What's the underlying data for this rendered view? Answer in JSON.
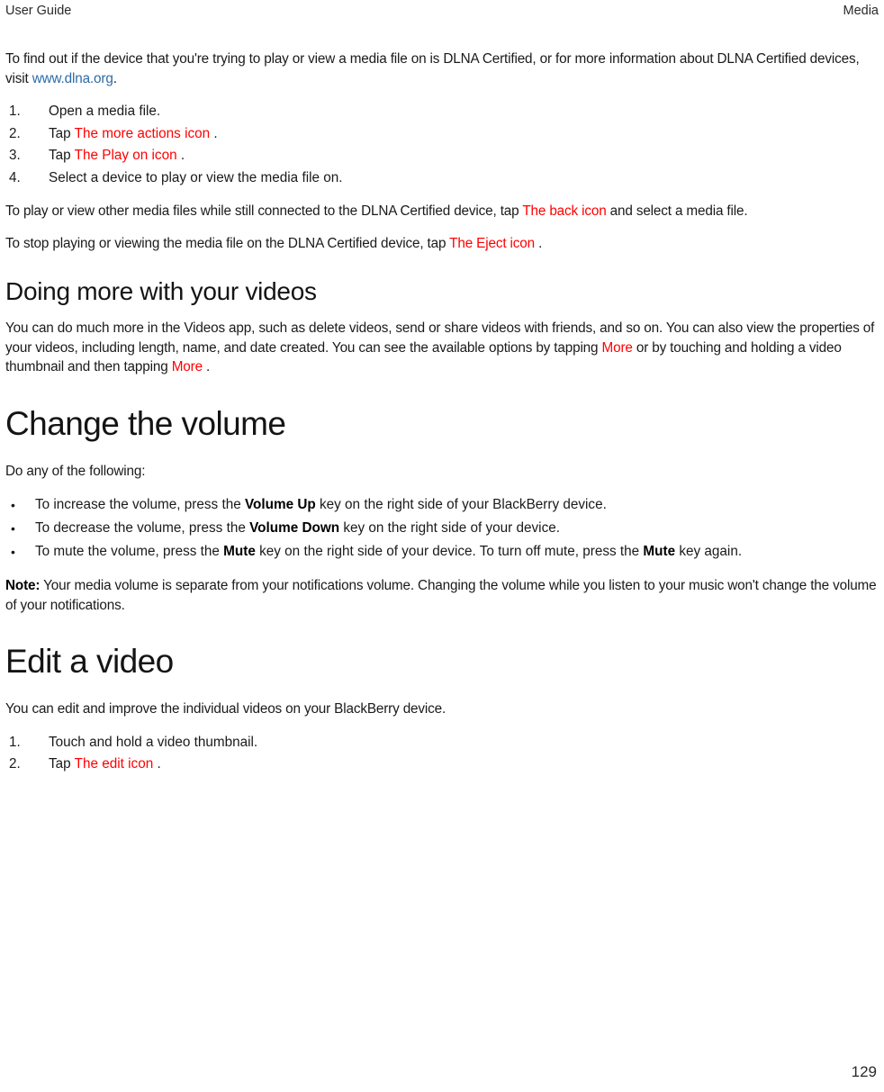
{
  "header": {
    "left": "User Guide",
    "right": "Media"
  },
  "colors": {
    "icon_reference": "#ff0000",
    "link": "#2d6ca8",
    "text": "#1a1a1a",
    "page_background": "#ffffff"
  },
  "intro": {
    "part1": "To find out if the device that you're trying to play or view a media file on is DLNA Certified, or for more information about DLNA Certified devices, visit ",
    "link_text": "www.dlna.org",
    "part2": "."
  },
  "dlna_steps": [
    {
      "number": "1.",
      "before": "Open a media file.",
      "icon": "",
      "after": ""
    },
    {
      "number": "2.",
      "before": "Tap ",
      "icon": "The more actions icon",
      "after": " ."
    },
    {
      "number": "3.",
      "before": "Tap ",
      "icon": "The Play on icon",
      "after": " ."
    },
    {
      "number": "4.",
      "before": "Select a device to play or view the media file on.",
      "icon": "",
      "after": ""
    }
  ],
  "after_steps": {
    "para1_before": "To play or view other media files while still connected to the DLNA Certified device, tap ",
    "para1_icon": "The back icon",
    "para1_after": " and select a media file.",
    "para2_before": "To stop playing or viewing the media file on the DLNA Certified device, tap ",
    "para2_icon": "The Eject icon",
    "para2_after": " ."
  },
  "doing_more": {
    "heading": "Doing more with your videos",
    "body_before": "You can do much more in the Videos app, such as delete videos, send or share videos with friends, and so on. You can also view the properties of your videos, including length, name, and date created. You can see the available options by tapping ",
    "icon1": "More",
    "body_middle": " or by touching and holding a video thumbnail and then tapping ",
    "icon2": "More",
    "body_after": " ."
  },
  "change_volume": {
    "heading": "Change the volume",
    "lead": "Do any of the following:",
    "bullets": [
      {
        "marker": "•",
        "before": "To increase the volume, press the ",
        "strong": "Volume Up",
        "after": " key on the right side of your BlackBerry device.",
        "strong2": "",
        "after2": ""
      },
      {
        "marker": "•",
        "before": "To decrease the volume, press the ",
        "strong": "Volume Down",
        "after": " key on the right side of your device.",
        "strong2": "",
        "after2": ""
      },
      {
        "marker": "•",
        "before": "To mute the volume, press the ",
        "strong": "Mute",
        "after": " key on the right side of your device. To turn off mute, press the ",
        "strong2": "Mute",
        "after2": " key again."
      }
    ],
    "note_label": "Note:",
    "note_text": " Your media volume is separate from your notifications volume. Changing the volume while you listen to your music won't change the volume of your notifications."
  },
  "edit_video": {
    "heading": "Edit a video",
    "intro": "You can edit and improve the individual videos on your BlackBerry device.",
    "steps": [
      {
        "number": "1.",
        "before": "Touch and hold a video thumbnail.",
        "icon": "",
        "after": ""
      },
      {
        "number": "2.",
        "before": "Tap ",
        "icon": "The edit icon",
        "after": " ."
      }
    ]
  },
  "footer": {
    "page_number": "129"
  }
}
